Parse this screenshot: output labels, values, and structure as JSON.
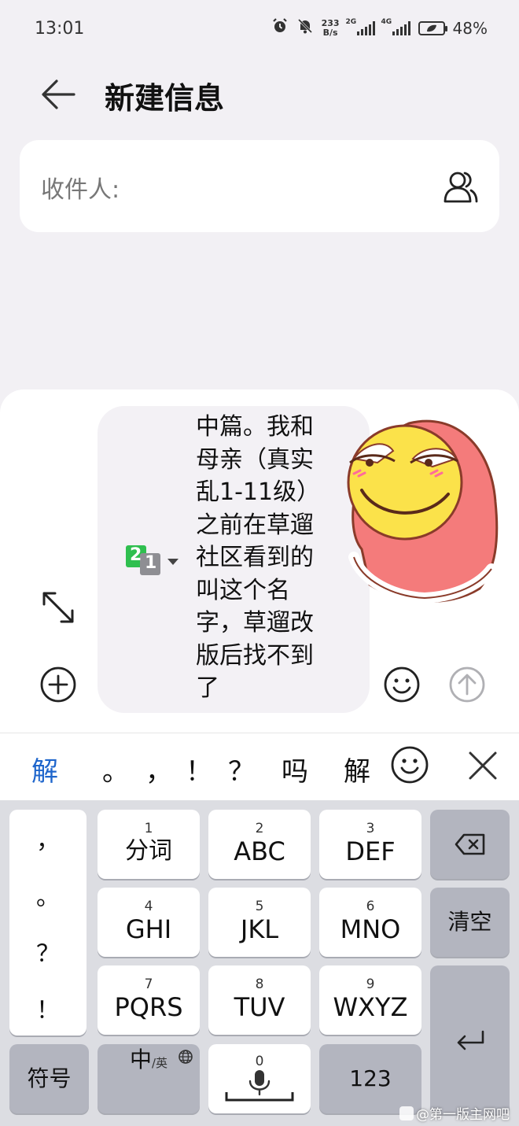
{
  "status_bar": {
    "time": "13:01",
    "net_speed_value": "233",
    "net_speed_unit": "B/s",
    "sim1_label": "2G",
    "sim2_label": "4G",
    "battery": "48%"
  },
  "header": {
    "title": "新建信息"
  },
  "recipient": {
    "label": "收件人:"
  },
  "compose": {
    "sim_primary": "2",
    "sim_secondary": "1",
    "message_lines": [
      "中篇。我和",
      "母亲（真实",
      "乱1-11级）",
      "之前在草遛",
      "社区看到的",
      "叫这个名",
      "字，草遛改",
      "版后找不到",
      "了"
    ]
  },
  "candidates": {
    "items": [
      "解",
      "。",
      "，",
      "！",
      "？",
      "吗",
      "解"
    ]
  },
  "keyboard": {
    "punct_column": [
      "，",
      "。",
      "？",
      "！"
    ],
    "keys": {
      "k1": {
        "num": "1",
        "label": "分词"
      },
      "k2": {
        "num": "2",
        "label": "ABC"
      },
      "k3": {
        "num": "3",
        "label": "DEF"
      },
      "k4": {
        "num": "4",
        "label": "GHI"
      },
      "k5": {
        "num": "5",
        "label": "JKL"
      },
      "k6": {
        "num": "6",
        "label": "MNO"
      },
      "k7": {
        "num": "7",
        "label": "PQRS"
      },
      "k8": {
        "num": "8",
        "label": "TUV"
      },
      "k9": {
        "num": "9",
        "label": "WXYZ"
      },
      "k0": {
        "num": "0"
      }
    },
    "clear_label": "清空",
    "symbols_label": "符号",
    "lang_main": "中",
    "lang_sub": "/英",
    "numbers_label": "123"
  },
  "watermark": "@第一版主网吧",
  "colors": {
    "accent_blue": "#1f66cc",
    "sim_green": "#2fbf4f",
    "background": "#f2f0f4",
    "keyboard_bg": "#dcdde2"
  }
}
